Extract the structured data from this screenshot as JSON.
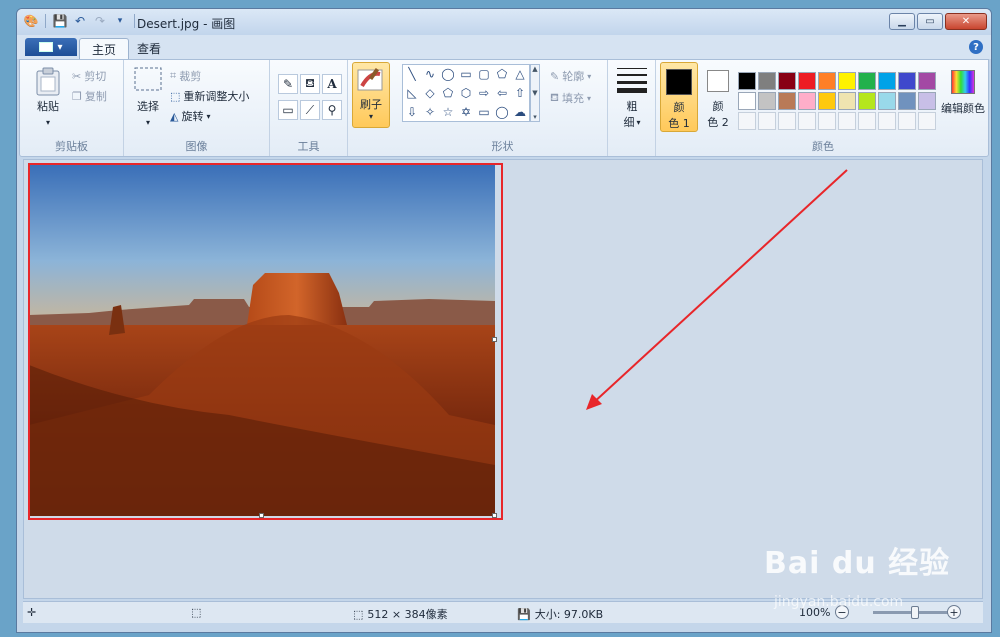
{
  "window": {
    "title": "Desert.jpg - 画图"
  },
  "tabs": [
    {
      "label": "主页"
    },
    {
      "label": "查看"
    }
  ],
  "clipboard": {
    "paste": "粘贴",
    "cut": "剪切",
    "copy": "复制",
    "group": "剪贴板"
  },
  "image": {
    "select": "选择",
    "crop": "裁剪",
    "resize": "重新调整大小",
    "rotate": "旋转",
    "group": "图像"
  },
  "tools": {
    "group": "工具",
    "text_glyph": "A"
  },
  "brushes": {
    "label": "刷子"
  },
  "shapes": {
    "outline": "轮廓",
    "fill": "填充",
    "group": "形状"
  },
  "size": {
    "label_line1": "粗",
    "label_line2": "细"
  },
  "colors": {
    "color1_line1": "颜",
    "color1_line2": "色 1",
    "color2_line1": "颜",
    "color2_line2": "色 2",
    "edit": "编辑颜色",
    "group": "颜色",
    "color1_value": "#000000",
    "color2_value": "#ffffff",
    "palette": [
      "#000000",
      "#7f7f7f",
      "#880015",
      "#ed1c24",
      "#ff7f27",
      "#fff200",
      "#22b14c",
      "#00a2e8",
      "#3f48cc",
      "#a349a4",
      "#ffffff",
      "#c3c3c3",
      "#b97a57",
      "#ffaec9",
      "#ffc90e",
      "#efe4b0",
      "#b5e61d",
      "#99d9ea",
      "#7092be",
      "#c8bfe7",
      "#f4f6f9",
      "#f4f6f9",
      "#f4f6f9",
      "#f4f6f9",
      "#f4f6f9",
      "#f4f6f9",
      "#f4f6f9",
      "#f4f6f9",
      "#f4f6f9",
      "#f4f6f9"
    ]
  },
  "status": {
    "dimensions": "512 × 384像素",
    "size": "大小: 97.0KB",
    "zoom": "100%"
  },
  "watermark": {
    "brand": "Bai du 经验",
    "url": "jingyan.baidu.com"
  }
}
